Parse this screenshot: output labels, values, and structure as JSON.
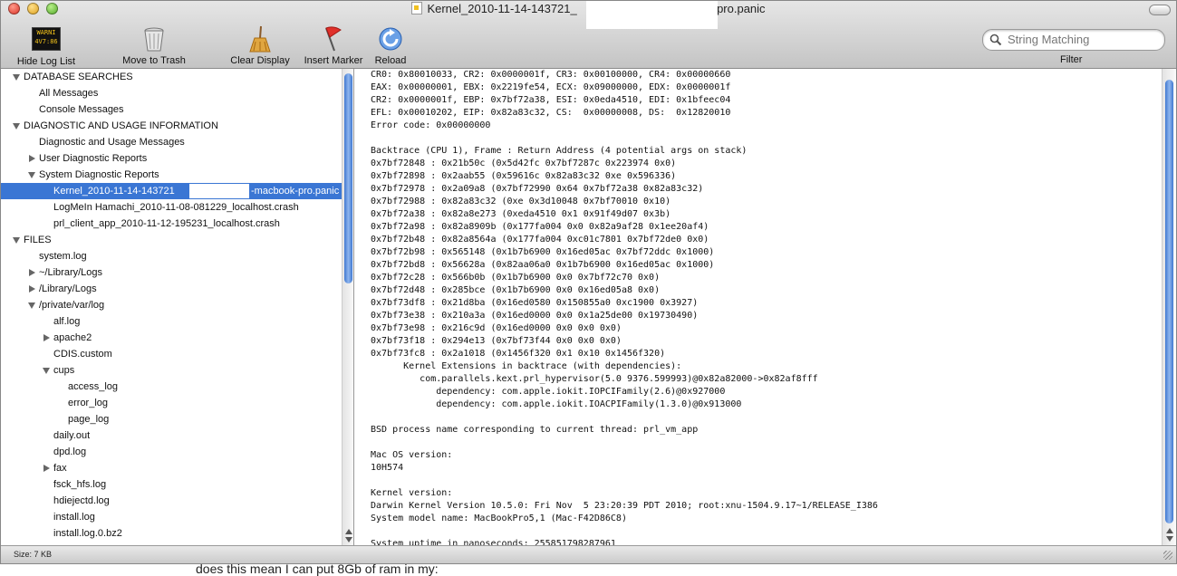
{
  "window": {
    "title_prefix": "Kernel_2010-11-14-143721_",
    "title_suffix": "-pro.panic"
  },
  "toolbar": {
    "hide_log_list": "Hide Log List",
    "hide_icon_text": "WARNI\n4V7:86",
    "move_to_trash": "Move to Trash",
    "clear_display": "Clear Display",
    "insert_marker": "Insert Marker",
    "reload": "Reload",
    "search_placeholder": "String Matching",
    "filter": "Filter"
  },
  "sidebar": {
    "items": [
      {
        "label": "DATABASE SEARCHES",
        "level": 0,
        "tri": "open",
        "header": true
      },
      {
        "label": "All Messages",
        "level": 1,
        "tri": "none"
      },
      {
        "label": "Console Messages",
        "level": 1,
        "tri": "none"
      },
      {
        "label": "DIAGNOSTIC AND USAGE INFORMATION",
        "level": 0,
        "tri": "open",
        "header": true
      },
      {
        "label": "Diagnostic and Usage Messages",
        "level": 1,
        "tri": "none"
      },
      {
        "label": "User Diagnostic Reports",
        "level": 1,
        "tri": "closed"
      },
      {
        "label": "System Diagnostic Reports",
        "level": 1,
        "tri": "open"
      },
      {
        "label": "Kernel_2010-11-14-143721",
        "label2": "-macbook-pro.panic",
        "level": 2,
        "tri": "none",
        "selected": true
      },
      {
        "label": "LogMeIn Hamachi_2010-11-08-081229_localhost.crash",
        "level": 2,
        "tri": "none"
      },
      {
        "label": "prl_client_app_2010-11-12-195231_localhost.crash",
        "level": 2,
        "tri": "none"
      },
      {
        "label": "FILES",
        "level": 0,
        "tri": "open",
        "header": true
      },
      {
        "label": "system.log",
        "level": 1,
        "tri": "none"
      },
      {
        "label": "~/Library/Logs",
        "level": 1,
        "tri": "closed"
      },
      {
        "label": "/Library/Logs",
        "level": 1,
        "tri": "closed"
      },
      {
        "label": "/private/var/log",
        "level": 1,
        "tri": "open"
      },
      {
        "label": "alf.log",
        "level": 2,
        "tri": "none"
      },
      {
        "label": "apache2",
        "level": 2,
        "tri": "closed"
      },
      {
        "label": "CDIS.custom",
        "level": 2,
        "tri": "none"
      },
      {
        "label": "cups",
        "level": 2,
        "tri": "open"
      },
      {
        "label": "access_log",
        "level": 3,
        "tri": "none"
      },
      {
        "label": "error_log",
        "level": 3,
        "tri": "none"
      },
      {
        "label": "page_log",
        "level": 3,
        "tri": "none"
      },
      {
        "label": "daily.out",
        "level": 2,
        "tri": "none"
      },
      {
        "label": "dpd.log",
        "level": 2,
        "tri": "none"
      },
      {
        "label": "fax",
        "level": 2,
        "tri": "closed"
      },
      {
        "label": "fsck_hfs.log",
        "level": 2,
        "tri": "none"
      },
      {
        "label": "hdiejectd.log",
        "level": 2,
        "tri": "none"
      },
      {
        "label": "install.log",
        "level": 2,
        "tri": "none"
      },
      {
        "label": "install.log.0.bz2",
        "level": 2,
        "tri": "none"
      }
    ]
  },
  "log": {
    "lines": [
      "CR0: 0x80010033, CR2: 0x0000001f, CR3: 0x00100000, CR4: 0x00000660",
      "EAX: 0x00000001, EBX: 0x2219fe54, ECX: 0x09000000, EDX: 0x0000001f",
      "CR2: 0x0000001f, EBP: 0x7bf72a38, ESI: 0x0eda4510, EDI: 0x1bfeec04",
      "EFL: 0x00010202, EIP: 0x82a83c32, CS:  0x00000008, DS:  0x12820010",
      "Error code: 0x00000000",
      "",
      "Backtrace (CPU 1), Frame : Return Address (4 potential args on stack)",
      "0x7bf72848 : 0x21b50c (0x5d42fc 0x7bf7287c 0x223974 0x0)",
      "0x7bf72898 : 0x2aab55 (0x59616c 0x82a83c32 0xe 0x596336)",
      "0x7bf72978 : 0x2a09a8 (0x7bf72990 0x64 0x7bf72a38 0x82a83c32)",
      "0x7bf72988 : 0x82a83c32 (0xe 0x3d10048 0x7bf70010 0x10)",
      "0x7bf72a38 : 0x82a8e273 (0xeda4510 0x1 0x91f49d07 0x3b)",
      "0x7bf72a98 : 0x82a8909b (0x177fa004 0x0 0x82a9af28 0x1ee20af4)",
      "0x7bf72b48 : 0x82a8564a (0x177fa004 0xc01c7801 0x7bf72de0 0x0)",
      "0x7bf72b98 : 0x565148 (0x1b7b6900 0x16ed05ac 0x7bf72ddc 0x1000)",
      "0x7bf72bd8 : 0x56628a (0x82aa06a0 0x1b7b6900 0x16ed05ac 0x1000)",
      "0x7bf72c28 : 0x566b0b (0x1b7b6900 0x0 0x7bf72c70 0x0)",
      "0x7bf72d48 : 0x285bce (0x1b7b6900 0x0 0x16ed05a8 0x0)",
      "0x7bf73df8 : 0x21d8ba (0x16ed0580 0x150855a0 0xc1900 0x3927)",
      "0x7bf73e38 : 0x210a3a (0x16ed0000 0x0 0x1a25de00 0x19730490)",
      "0x7bf73e98 : 0x216c9d (0x16ed0000 0x0 0x0 0x0)",
      "0x7bf73f18 : 0x294e13 (0x7bf73f44 0x0 0x0 0x0)",
      "0x7bf73fc8 : 0x2a1018 (0x1456f320 0x1 0x10 0x1456f320)",
      "      Kernel Extensions in backtrace (with dependencies):",
      "         com.parallels.kext.prl_hypervisor(5.0 9376.599993)@0x82a82000->0x82af8fff",
      "            dependency: com.apple.iokit.IOPCIFamily(2.6)@0x927000",
      "            dependency: com.apple.iokit.IOACPIFamily(1.3.0)@0x913000",
      "",
      "BSD process name corresponding to current thread: prl_vm_app",
      "",
      "Mac OS version:",
      "10H574",
      "",
      "Kernel version:",
      "Darwin Kernel Version 10.5.0: Fri Nov  5 23:20:39 PDT 2010; root:xnu-1504.9.17~1/RELEASE_I386",
      "System model name: MacBookPro5,1 (Mac-F42D86C8)",
      "",
      "System uptime in nanoseconds: 255851798287961"
    ]
  },
  "status": {
    "size": "Size: 7 KB"
  },
  "below_text": "does this mean I can put 8Gb of ram in my:",
  "colors": {
    "selection": "#3a76d4",
    "scroll_thumb": "#3f78d0"
  }
}
